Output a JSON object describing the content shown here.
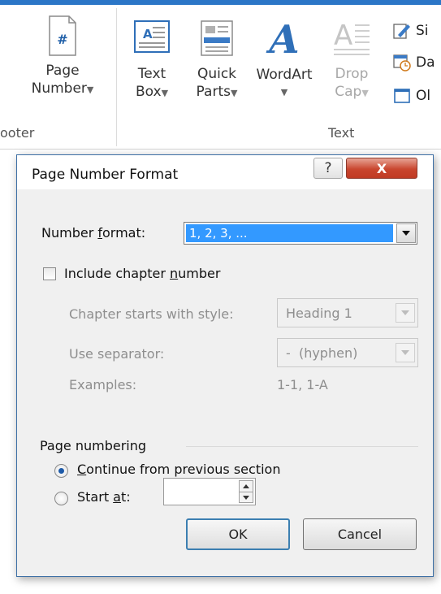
{
  "ribbon": {
    "page_number": {
      "line1": "Page",
      "line2": "Number",
      "icon_text": "#"
    },
    "footer_group_label": "ooter",
    "text_box": {
      "line1": "Text",
      "line2": "Box"
    },
    "quick_parts": {
      "line1": "Quick",
      "line2": "Parts"
    },
    "wordart": {
      "line1": "WordArt"
    },
    "drop_cap": {
      "line1": "Drop",
      "line2": "Cap"
    },
    "side_items": [
      "Si",
      "Da",
      "Ol"
    ],
    "text_group_label": "Text"
  },
  "dialog": {
    "title": "Page Number Format",
    "help_label": "?",
    "close_label": "X",
    "number_format": {
      "label_pre": "Number ",
      "label_ul": "f",
      "label_post": "ormat:",
      "value": "1, 2, 3, ..."
    },
    "include_chapter": {
      "label_pre": "Include chapter ",
      "label_ul": "n",
      "label_post": "umber",
      "checked": false
    },
    "chapter_style": {
      "label": "Chapter starts with style:",
      "value": "Heading 1"
    },
    "separator": {
      "label": "Use separator:",
      "value": "-  (hyphen)"
    },
    "examples": {
      "label": "Examples:",
      "value": "1-1, 1-A"
    },
    "page_numbering": {
      "label": "Page numbering",
      "continue": {
        "label_ul": "C",
        "label_post": "ontinue from previous section",
        "selected": true
      },
      "start_at": {
        "label_pre": "Start ",
        "label_ul": "a",
        "label_post": "t:",
        "selected": false,
        "value": ""
      }
    },
    "ok_label": "OK",
    "cancel_label": "Cancel"
  },
  "colors": {
    "accent": "#2b76c7",
    "selection": "#3399ff",
    "close_button": "#c9462f"
  }
}
